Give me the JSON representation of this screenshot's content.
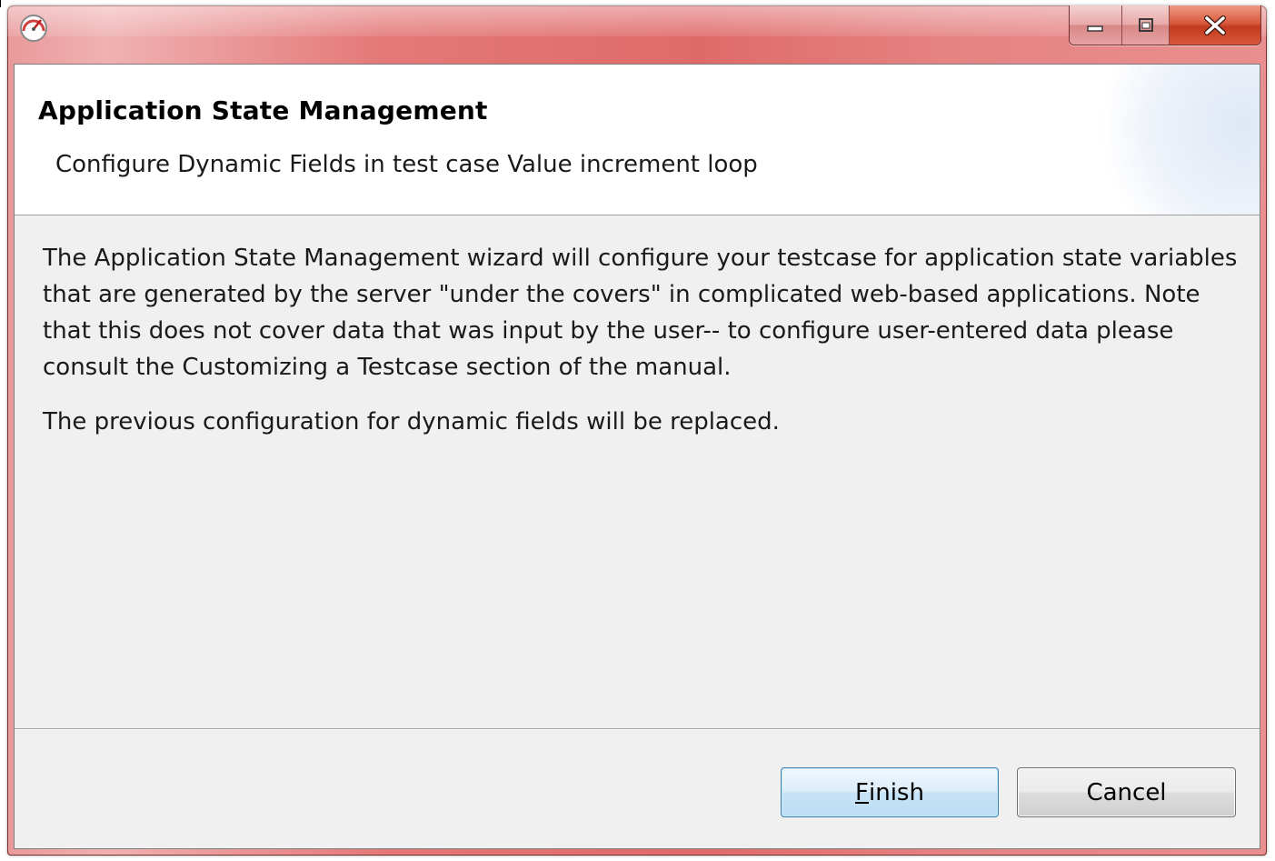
{
  "window": {
    "title": "",
    "controls": {
      "minimize_icon": "minimize-icon",
      "maximize_icon": "maximize-icon",
      "close_icon": "close-icon"
    }
  },
  "header": {
    "title": "Application State Management",
    "subtitle": "Configure Dynamic Fields in test case Value increment loop"
  },
  "body": {
    "paragraphs": [
      "The Application State Management wizard will configure your testcase for application state variables that are generated by the server \"under the covers\" in complicated web-based applications. Note that this does not cover data that was input by the user-- to configure user-entered data please consult the Customizing a Testcase section of the manual.",
      "The previous configuration for dynamic fields will be replaced."
    ]
  },
  "buttons": {
    "finish": {
      "mnemonic": "F",
      "rest": "inish"
    },
    "cancel": "Cancel"
  },
  "colors": {
    "titlebar": "#e06a6a",
    "close_button": "#c23a1e",
    "dialog_background": "#f0f0f0",
    "default_button_border": "#3c7fb1"
  }
}
